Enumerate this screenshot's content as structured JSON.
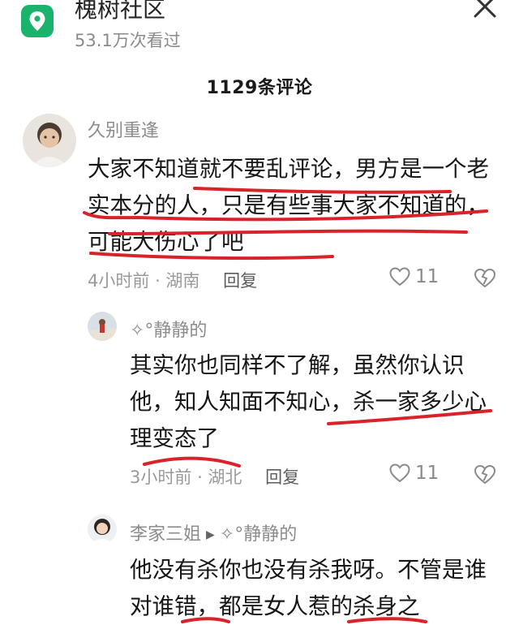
{
  "header": {
    "app_name": "槐树社区",
    "views": "53.1万次看过"
  },
  "comments_title": "1129条评论",
  "comments": [
    {
      "user": "久别重逢",
      "text": "大家不知道就不要乱评论，男方是一个老实本分的人，只是有些事大家不知道的，可能大伤心了吧",
      "time": "4小时前",
      "location": "湖南",
      "reply_label": "回复",
      "likes": "11"
    },
    {
      "user": "✧°静静的",
      "text": "其实你也同样不了解，虽然你认识他，知人知面不知心，杀一家多少心理变态了",
      "time": "3小时前",
      "location": "湖北",
      "reply_label": "回复",
      "likes": "11"
    },
    {
      "user": "李家三姐",
      "reply_to": "✧°静静的",
      "text": "他没有杀你也没有杀我呀。不管是谁对谁错，都是女人惹的杀身之"
    }
  ],
  "icons": {
    "app": "map-location-icon",
    "close": "close-icon",
    "like": "heart-icon",
    "dislike": "broken-heart-icon"
  },
  "colors": {
    "app_icon": "#19b36b",
    "annotation_red": "#d9222a"
  }
}
